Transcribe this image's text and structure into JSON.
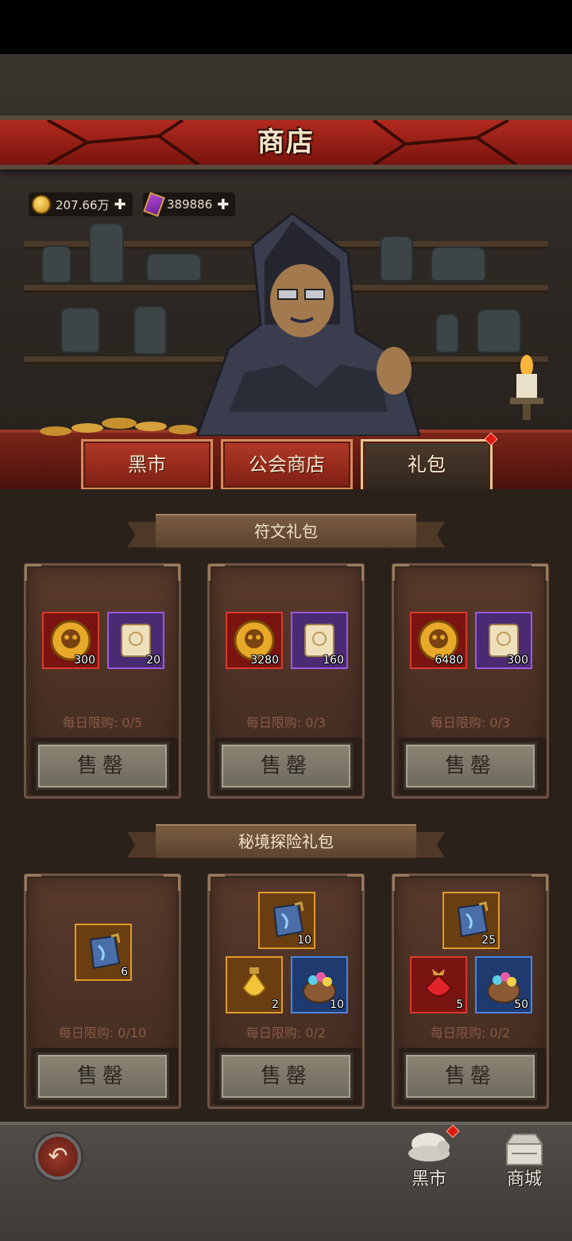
{
  "header": {
    "title": "商店"
  },
  "currencies": [
    {
      "icon": "skull-coin-icon",
      "amount": "207.66万"
    },
    {
      "icon": "card-icon",
      "amount": "389886"
    }
  ],
  "tabs": [
    {
      "label": "黑市",
      "active": false
    },
    {
      "label": "公会商店",
      "active": false
    },
    {
      "label": "礼包",
      "active": true
    }
  ],
  "sections": [
    {
      "title": "符文礼包",
      "packs": [
        {
          "items": [
            {
              "icon": "skull-coin-icon",
              "rarity": "red",
              "qty": "300"
            },
            {
              "icon": "scroll-icon",
              "rarity": "purple",
              "qty": "20"
            }
          ],
          "limit": "每日限购: 0/5",
          "button": "售罄"
        },
        {
          "items": [
            {
              "icon": "skull-coin-icon",
              "rarity": "red",
              "qty": "3280"
            },
            {
              "icon": "scroll-icon",
              "rarity": "purple",
              "qty": "160"
            }
          ],
          "limit": "每日限购: 0/3",
          "button": "售罄"
        },
        {
          "items": [
            {
              "icon": "skull-coin-icon",
              "rarity": "red",
              "qty": "6480"
            },
            {
              "icon": "scroll-icon",
              "rarity": "purple",
              "qty": "300"
            }
          ],
          "limit": "每日限购: 0/3",
          "button": "售罄"
        }
      ]
    },
    {
      "title": "秘境探险礼包",
      "packs": [
        {
          "items": [
            {
              "icon": "rune-stone-icon",
              "rarity": "orange",
              "qty": "6"
            }
          ],
          "limit": "每日限购: 0/10",
          "button": "售罄"
        },
        {
          "items": [
            {
              "icon": "rune-stone-icon",
              "rarity": "orange",
              "qty": "10"
            },
            {
              "icon": "gold-potion-icon",
              "rarity": "orange",
              "qty": "2"
            },
            {
              "icon": "gem-bag-icon",
              "rarity": "blue",
              "qty": "10"
            }
          ],
          "limit": "每日限购: 0/2",
          "button": "售罄"
        },
        {
          "items": [
            {
              "icon": "rune-stone-icon",
              "rarity": "orange",
              "qty": "25"
            },
            {
              "icon": "red-potion-icon",
              "rarity": "red",
              "qty": "5"
            },
            {
              "icon": "gem-bag-icon",
              "rarity": "blue",
              "qty": "50"
            }
          ],
          "limit": "每日限购: 0/2",
          "button": "售罄"
        }
      ]
    }
  ],
  "bottom_nav": {
    "back": "back-arrow-icon",
    "items": [
      {
        "label": "黑市",
        "icon": "merchant-icon",
        "badge": true
      },
      {
        "label": "商城",
        "icon": "treasure-chest-icon",
        "badge": false
      }
    ]
  },
  "colors": {
    "banner_red": "#b22a1e",
    "tab_red": "#b23a26",
    "panel_bg": "#2b211b",
    "limit_text": "#8a5a44"
  }
}
